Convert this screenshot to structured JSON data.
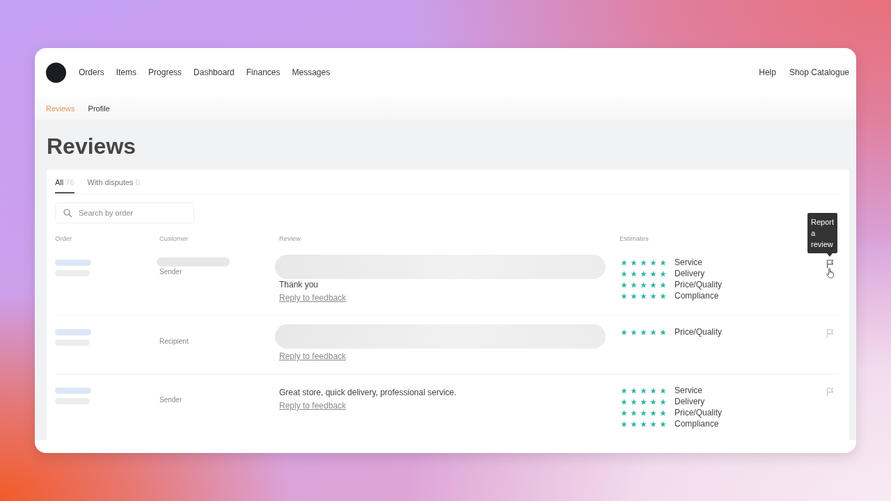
{
  "nav": {
    "items": [
      "Orders",
      "Items",
      "Progress",
      "Dashboard",
      "Finances",
      "Messages"
    ],
    "right_items": [
      "Help",
      "Shop Catalogue"
    ]
  },
  "subnav": [
    {
      "label": "Reviews",
      "selected": true
    },
    {
      "label": "Profile",
      "selected": false
    }
  ],
  "title": "Reviews",
  "tabs": [
    {
      "label": "All",
      "count": "76",
      "selected": true
    },
    {
      "label": "With disputes",
      "count": "0",
      "selected": false
    }
  ],
  "search": {
    "placeholder": "Search by order"
  },
  "table": {
    "columns": [
      "Order",
      "Customer",
      "Review",
      "Estimates"
    ],
    "rows": [
      {
        "customer_name_blurred": true,
        "customer_role": "Sender",
        "review_blurred": true,
        "review": "Thank you",
        "reply_link": "Reply to feedback",
        "estimates": [
          {
            "label": "Service",
            "stars": 5
          },
          {
            "label": "Delivery",
            "stars": 5
          },
          {
            "label": "Price/Quality",
            "stars": 5
          },
          {
            "label": "Compliance",
            "stars": 5
          }
        ],
        "flag": {
          "hovered": true,
          "tooltip": "Report a review"
        }
      },
      {
        "customer_name_blurred": false,
        "customer_role": "Recipient",
        "review_blurred": true,
        "reply_link": "Reply to feedback",
        "estimates": [
          {
            "label": "Price/Quality",
            "stars": 5
          }
        ],
        "flag": {
          "hovered": false
        }
      },
      {
        "customer_name_blurred": false,
        "customer_role": "Sender",
        "review_blurred": false,
        "review": "Great store, quick delivery, professional service.",
        "reply_link": "Reply to feedback",
        "estimates": [
          {
            "label": "Service",
            "stars": 5
          },
          {
            "label": "Delivery",
            "stars": 5
          },
          {
            "label": "Price/Quality",
            "stars": 5
          },
          {
            "label": "Compliance",
            "stars": 5
          }
        ],
        "flag": {
          "hovered": false
        }
      }
    ]
  }
}
